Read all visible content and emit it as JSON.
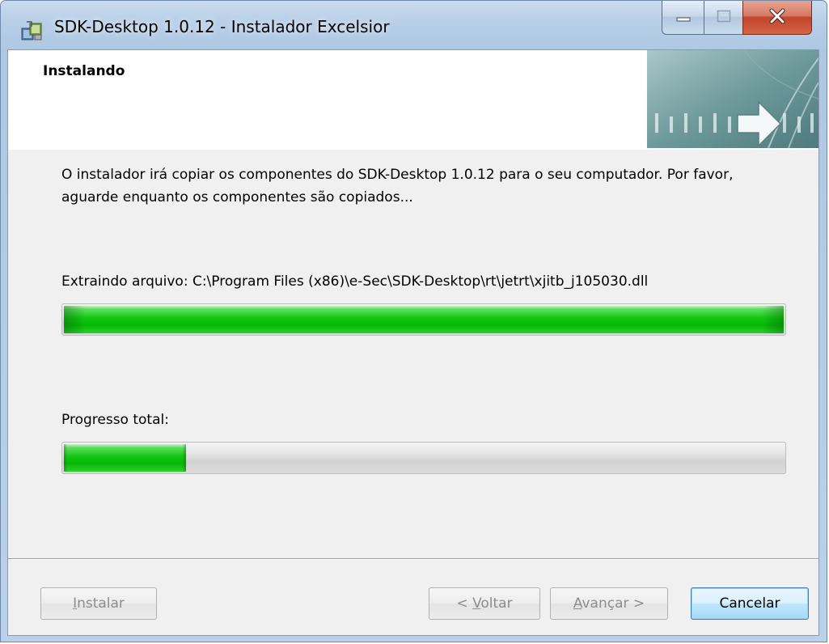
{
  "window": {
    "title": "SDK-Desktop 1.0.12 - Instalador Excelsior"
  },
  "banner": {
    "title": "Instalando"
  },
  "description": "O instalador irá copiar os componentes do SDK-Desktop 1.0.12 para o seu computador. Por favor, aguarde enquanto os componentes são copiados...",
  "file_progress": {
    "label": "Extraindo arquivo: C:\\Program Files (x86)\\e-Sec\\SDK-Desktop\\rt\\jetrt\\xjitb_j105030.dll",
    "value": 1.0
  },
  "total_progress": {
    "label": "Progresso total:",
    "value": 0.17
  },
  "buttons": {
    "install": {
      "label": "Instalar",
      "mnemonic_index": 0,
      "enabled": false
    },
    "back": {
      "label": "< Voltar",
      "mnemonic_index": 2,
      "enabled": false
    },
    "next": {
      "label": "Avançar >",
      "mnemonic_index": 0,
      "enabled": false
    },
    "cancel": {
      "label": "Cancelar",
      "enabled": true
    }
  },
  "colors": {
    "progress_green": "#06b806",
    "title_bar": "#b6cde6",
    "close_button": "#c0442a"
  },
  "icons": {
    "app": "installer-package-icon",
    "minimize": "minimize-icon",
    "maximize": "maximize-icon",
    "close": "close-icon"
  }
}
